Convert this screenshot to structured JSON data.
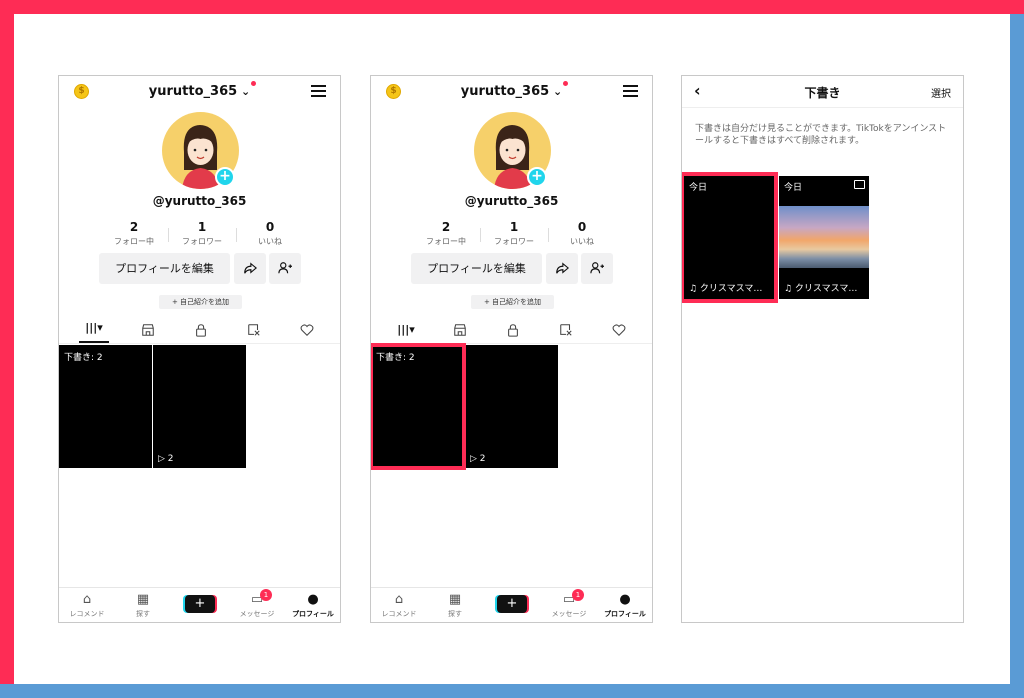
{
  "colors": {
    "accent": "#fe2c55",
    "secondary": "#5a9bd5",
    "cyan": "#20d5ec"
  },
  "profile": {
    "username": "yurutto_365",
    "handle": "@yurutto_365",
    "stats": [
      {
        "num": "2",
        "label": "フォロー中"
      },
      {
        "num": "1",
        "label": "フォロワー"
      },
      {
        "num": "0",
        "label": "いいね"
      }
    ],
    "edit_label": "プロフィールを編集",
    "bio_label": "+ 自己紹介を追加",
    "videos": [
      {
        "label": "下書き: 2"
      },
      {
        "plays": "▷ 2"
      }
    ]
  },
  "nav": {
    "items": [
      {
        "label": "レコメンド",
        "icon": "home-icon"
      },
      {
        "label": "探す",
        "icon": "discover-icon"
      },
      {
        "label": "+",
        "icon": "create-icon"
      },
      {
        "label": "メッセージ",
        "icon": "inbox-icon",
        "badge": "1"
      },
      {
        "label": "プロフィール",
        "icon": "profile-icon"
      }
    ]
  },
  "drafts": {
    "title": "下書き",
    "select_label": "選択",
    "note": "下書きは自分だけ見ることができます。TikTokをアンインストールすると下書きはすべて削除されます。",
    "items": [
      {
        "date": "今日",
        "song": "♫ クリスマスマ…"
      },
      {
        "date": "今日",
        "song": "♫ クリスマスマ…"
      }
    ]
  }
}
